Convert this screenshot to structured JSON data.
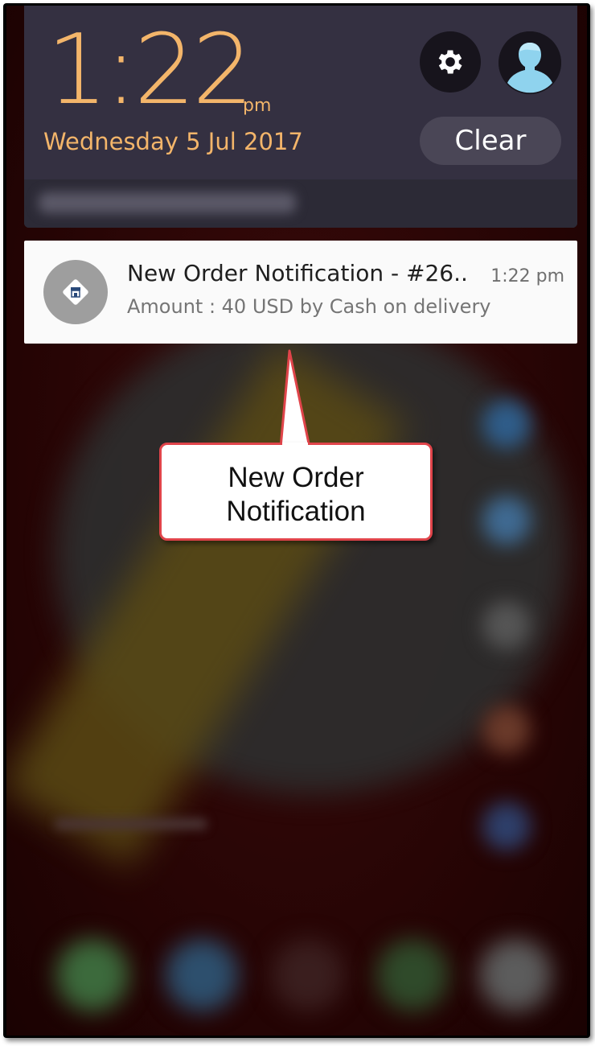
{
  "shade": {
    "time": "1:22",
    "ampm": "pm",
    "date": "Wednesday 5 Jul 2017",
    "clear_label": "Clear",
    "settings_icon": "gear-icon",
    "avatar_icon": "user-avatar-icon"
  },
  "notification": {
    "title": "New Order Notification - #26..",
    "time": "1:22 pm",
    "body": "Amount : 40 USD by Cash on delivery",
    "icon": "store-icon"
  },
  "callout": {
    "line1": "New Order",
    "line2": "Notification"
  },
  "colors": {
    "accent": "#f3b56a",
    "shade_bg": "#343041",
    "callout_border": "#e0444a"
  }
}
